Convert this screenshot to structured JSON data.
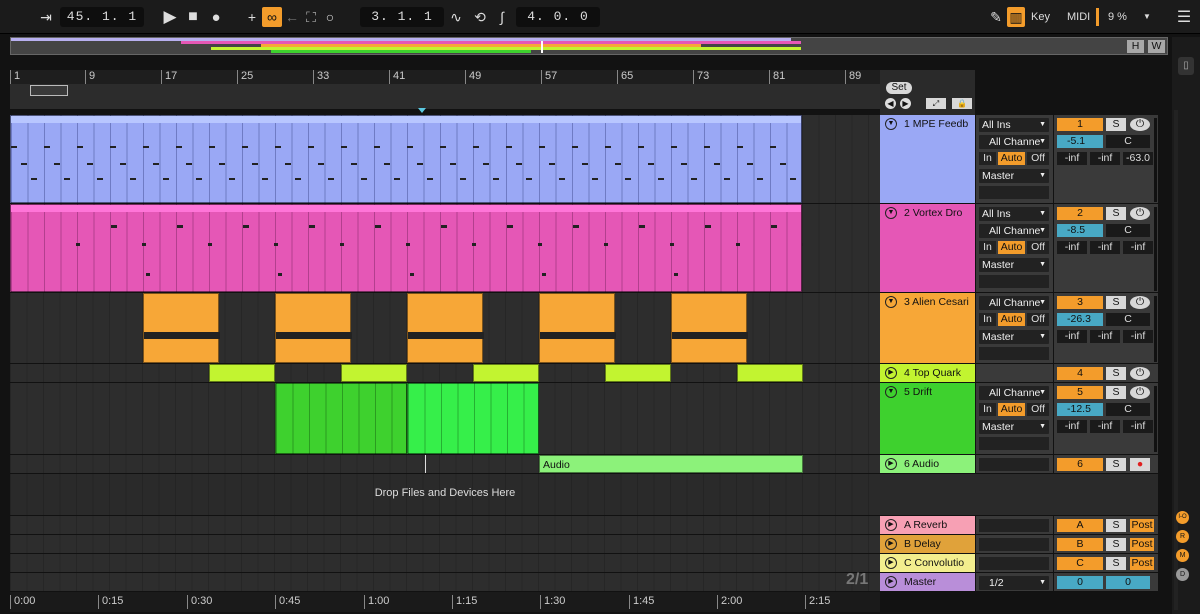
{
  "transport": {
    "position": "45. 1. 1",
    "loop_start": "3. 1. 1",
    "loop_length": "4. 0. 0"
  },
  "topright": {
    "key": "Key",
    "midi": "MIDI",
    "cpu": "9 %"
  },
  "overview": {
    "h": "H",
    "w": "W"
  },
  "ruler": [
    "1",
    "9",
    "17",
    "25",
    "33",
    "41",
    "49",
    "57",
    "65",
    "73",
    "81",
    "89"
  ],
  "set_label": "Set",
  "time_ruler": [
    "0:00",
    "0:15",
    "0:30",
    "0:45",
    "1:00",
    "1:15",
    "1:30",
    "1:45",
    "2:00",
    "2:15"
  ],
  "drop_hint": "Drop Files and Devices Here",
  "page_indicator": "2/1",
  "audio_clip_label": "Audio",
  "colors": {
    "track1": "#9aa8f5",
    "track2": "#e557b6",
    "track3": "#f7a737",
    "track4": "#c2f430",
    "track5": "#3ed12e",
    "track6": "#8cf27a",
    "returnA": "#f7a0b4",
    "returnB": "#e0a23a",
    "returnC": "#f3ee8e",
    "master": "#b98ed9",
    "accent": "#f39c2b"
  },
  "tracks": [
    {
      "name": "1 MPE Feedb",
      "input": "All Ins",
      "channel": "All Channe",
      "monitor": [
        "In",
        "Auto",
        "Off"
      ],
      "output": "Master",
      "number": "1",
      "solo": "S",
      "volume": "-5.1",
      "pan": "C",
      "meters": [
        "-inf",
        "-inf",
        "-63.0"
      ]
    },
    {
      "name": "2 Vortex Dro",
      "input": "All Ins",
      "channel": "All Channe",
      "monitor": [
        "In",
        "Auto",
        "Off"
      ],
      "output": "Master",
      "number": "2",
      "solo": "S",
      "volume": "-8.5",
      "pan": "C",
      "meters": [
        "-inf",
        "-inf",
        "-inf"
      ]
    },
    {
      "name": "3 Alien Cesari",
      "channel": "All Channe",
      "monitor": [
        "In",
        "Auto",
        "Off"
      ],
      "output": "Master",
      "number": "3",
      "solo": "S",
      "volume": "-26.3",
      "pan": "C",
      "meters": [
        "-inf",
        "-inf",
        "-inf"
      ]
    },
    {
      "name": "4 Top Quark",
      "number": "4",
      "solo": "S"
    },
    {
      "name": "5 Drift",
      "channel": "All Channe",
      "monitor": [
        "In",
        "Auto",
        "Off"
      ],
      "output": "Master",
      "number": "5",
      "solo": "S",
      "volume": "-12.5",
      "pan": "C",
      "meters": [
        "-inf",
        "-inf",
        "-inf"
      ]
    },
    {
      "name": "6 Audio",
      "number": "6",
      "solo": "S"
    }
  ],
  "returns": [
    {
      "name": "A Reverb",
      "letter": "A",
      "solo": "S",
      "post": "Post"
    },
    {
      "name": "B Delay",
      "letter": "B",
      "solo": "S",
      "post": "Post"
    },
    {
      "name": "C Convolutio",
      "letter": "C",
      "solo": "S",
      "post": "Post"
    }
  ],
  "master": {
    "name": "Master",
    "cue": "1/2",
    "vol": "0",
    "pan": "0"
  },
  "side_letters": [
    "I-O",
    "R",
    "M",
    "D"
  ]
}
